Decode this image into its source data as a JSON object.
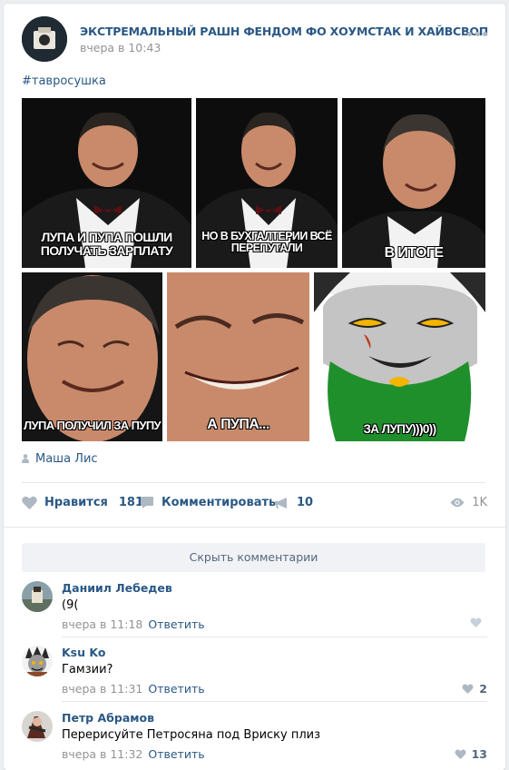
{
  "post": {
    "group_name": "ЭКСТРЕМАЛЬНЫЙ РАШН ФЕНДОМ ФО ХОУМСТАК И ХАЙВСВОП",
    "time": "вчера в 10:43",
    "hashtag": "#тавросушка",
    "photos": [
      {
        "caption_lines": [
          "Лупа и Пупа пошли",
          "получать зарплату"
        ]
      },
      {
        "caption_lines": [
          "Но в бухгалтерии всё",
          "перепутали"
        ]
      },
      {
        "caption_lines": [
          "В итоге"
        ]
      },
      {
        "caption_lines": [
          "Лупа получил за Пупу"
        ]
      },
      {
        "caption_lines": [
          "А Пупа..."
        ]
      },
      {
        "caption_lines": [
          "за Лупу)))0))"
        ]
      }
    ],
    "author": "Маша Лис"
  },
  "actions": {
    "like_label": "Нравится",
    "like_count": "181",
    "comment_label": "Комментировать",
    "share_count": "10",
    "views": "1K"
  },
  "comments_toggle": "Скрыть комментарии",
  "comments": [
    {
      "name": "Даниил Лебедев",
      "text": "(9(",
      "time": "вчера в 11:18",
      "reply": "Ответить",
      "likes": ""
    },
    {
      "name": "Ksu Ko",
      "text": "Гамзии?",
      "time": "вчера в 11:31",
      "reply": "Ответить",
      "likes": "2"
    },
    {
      "name": "Петр Абрамов",
      "text": "Перерисуйте Петросяна под Вриску плиз",
      "time": "вчера в 11:32",
      "reply": "Ответить",
      "likes": "13"
    }
  ],
  "colors": {
    "link": "#2a5885",
    "muted": "#939393",
    "icon": "#aeb8c2",
    "cat_face": "#c4c4c4",
    "cat_eye": "#f5b400"
  }
}
